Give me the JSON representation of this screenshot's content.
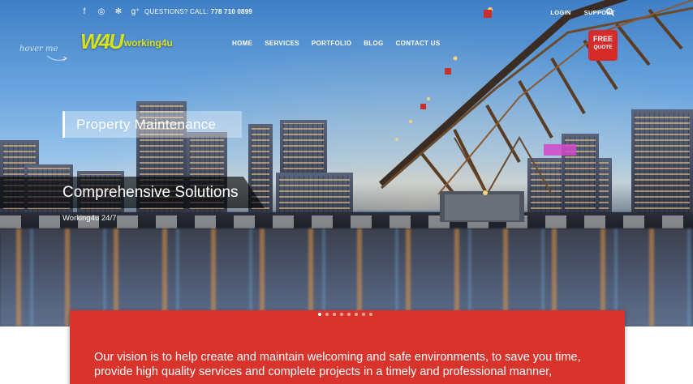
{
  "top_bar": {
    "social": [
      {
        "name": "facebook-icon",
        "glyph": "f"
      },
      {
        "name": "instagram-icon",
        "glyph": "◎"
      },
      {
        "name": "yelp-icon",
        "glyph": "✻"
      },
      {
        "name": "google-plus-icon",
        "glyph": "g⁺"
      }
    ],
    "question_label": "QUESTIONS? CALL:",
    "phone": "778 710 0899",
    "login": "LOGIN",
    "support": "SUPPORT"
  },
  "logo": {
    "mark": "W4U",
    "text": "working4u",
    "hover_hint": "hover me"
  },
  "nav": {
    "items": [
      "HOME",
      "SERVICES",
      "PORTFOLIO",
      "BLOG",
      "CONTACT US"
    ]
  },
  "free_quote": {
    "line1": "FREE",
    "line2": "QUOTE"
  },
  "slide": {
    "title": "Property Maintenance",
    "subtitle": "Comprehensive Solutions",
    "tag": "Working4u 24/7",
    "dot_count": 8,
    "active_dot": 0
  },
  "vision": {
    "line1": "Our vision is to help create and maintain welcoming and safe environments, to save you time,",
    "line2": "provide high quality services and complete projects in a timely and professional manner,"
  },
  "colors": {
    "accent_red": "#d8342c",
    "logo_lime": "#d8e21a"
  }
}
